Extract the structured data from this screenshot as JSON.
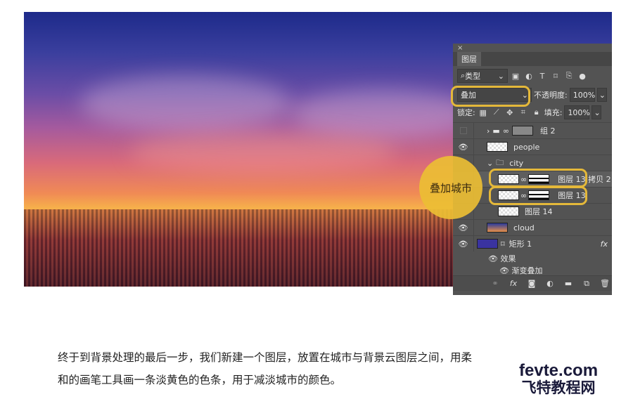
{
  "panel": {
    "close": "×",
    "tab": "图层",
    "filter": "类型",
    "blend_mode": "叠加",
    "opacity_label": "不透明度:",
    "opacity": "100%",
    "lock_label": "锁定:",
    "fill_label": "填充:",
    "fill": "100%",
    "layers": [
      {
        "name": "组 2",
        "visible": false
      },
      {
        "name": "people",
        "visible": true
      },
      {
        "name": "city",
        "visible": true
      },
      {
        "name": "图层 13 拷贝 2",
        "visible": true
      },
      {
        "name": "图层 13",
        "visible": true
      },
      {
        "name": "图层 14",
        "visible": false
      },
      {
        "name": "cloud",
        "visible": true
      },
      {
        "name": "矩形 1",
        "visible": true,
        "fx": "fx"
      },
      {
        "name": "效果"
      },
      {
        "name": "渐变叠加"
      }
    ],
    "bottom_icons": [
      "link-icon",
      "fx-icon",
      "mask-icon",
      "adjustment-icon",
      "folder-icon",
      "new-layer-icon",
      "trash-icon"
    ]
  },
  "callout": "叠加城市",
  "paragraph": [
    "终于到背景处理的最后一步，我们新建一个图层，放置在城市与背景云图层之间，用柔",
    "和的画笔工具画一条淡黄色的色条，用于减淡城市的颜色。"
  ],
  "watermark": {
    "line1": "fevte.com",
    "line2": "飞特教程网"
  },
  "colors": {
    "highlight": "#e4b83a",
    "panel": "#535353"
  }
}
